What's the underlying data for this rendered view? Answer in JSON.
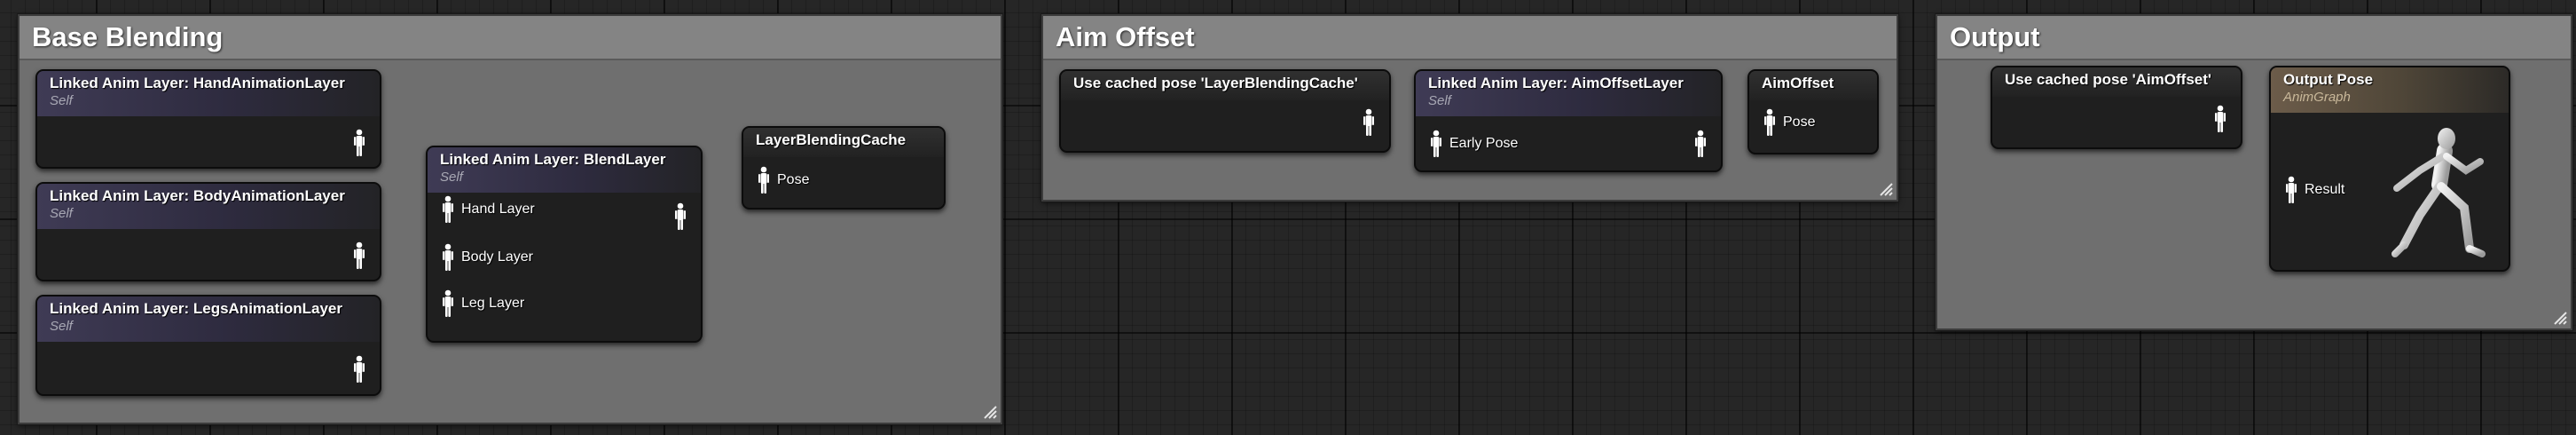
{
  "comments": {
    "base_blending": "Base Blending",
    "aim_offset": "Aim Offset",
    "output": "Output"
  },
  "nodes": {
    "hand": {
      "title": "Linked Anim Layer: HandAnimationLayer",
      "subtitle": "Self"
    },
    "body": {
      "title": "Linked Anim Layer: BodyAnimationLayer",
      "subtitle": "Self"
    },
    "legs": {
      "title": "Linked Anim Layer: LegsAnimationLayer",
      "subtitle": "Self"
    },
    "blend": {
      "title": "Linked Anim Layer: BlendLayer",
      "subtitle": "Self",
      "pins": [
        "Hand Layer",
        "Body Layer",
        "Leg Layer"
      ]
    },
    "cache_save": {
      "title": "LayerBlendingCache",
      "pin": "Pose"
    },
    "use_cache": {
      "title": "Use cached pose 'LayerBlendingCache'"
    },
    "aim_layer": {
      "title": "Linked Anim Layer: AimOffsetLayer",
      "subtitle": "Self",
      "pin": "Early Pose"
    },
    "aim_cache": {
      "title": "AimOffset",
      "pin": "Pose"
    },
    "use_aim": {
      "title": "Use cached pose 'AimOffset'"
    },
    "output_pose": {
      "title": "Output Pose",
      "subtitle": "AnimGraph",
      "pin": "Result"
    }
  },
  "icons": {
    "pose_pin": "pose-pin-icon",
    "mannequin": "mannequin-icon",
    "resize": "resize-grip-icon"
  },
  "colors": {
    "comment_bg": "#6f6f6f",
    "node_bg": "#1f1f1f",
    "wire": "#ffffff",
    "layer_header": "#3f3b55",
    "output_header": "#6c5c4a"
  }
}
